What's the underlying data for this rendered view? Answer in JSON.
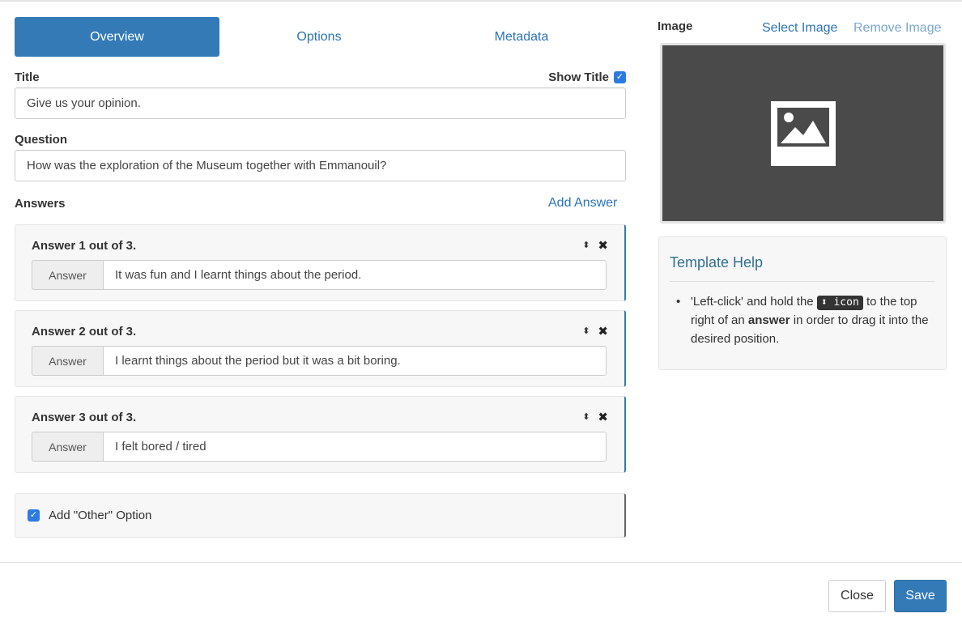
{
  "tabs": [
    {
      "label": "Overview",
      "active": true
    },
    {
      "label": "Options",
      "active": false
    },
    {
      "label": "Metadata",
      "active": false
    }
  ],
  "title_section": {
    "label": "Title",
    "show_title_label": "Show Title",
    "show_title_checked": true,
    "value": "Give us your opinion."
  },
  "question_section": {
    "label": "Question",
    "value": "How was the exploration of the Museum together with Emmanouil?"
  },
  "answers_section": {
    "label": "Answers",
    "add_answer_label": "Add Answer",
    "items": [
      {
        "title": "Answer 1 out of 3.",
        "addon": "Answer",
        "value": "It was fun and I learnt things about the period."
      },
      {
        "title": "Answer 2 out of 3.",
        "addon": "Answer",
        "value": "I learnt things about the period but it was a bit boring."
      },
      {
        "title": "Answer 3 out of 3.",
        "addon": "Answer",
        "value": "I felt bored / tired"
      }
    ]
  },
  "other_option": {
    "label": "Add \"Other\" Option",
    "checked": true
  },
  "image_section": {
    "label": "Image",
    "select_label": "Select Image",
    "remove_label": "Remove Image"
  },
  "template_help": {
    "title": "Template Help",
    "text_before": "'Left-click' and hold the",
    "code_label": "icon",
    "text_middle": "to the top right of an",
    "bold_word": "answer",
    "text_after": "in order to drag it into the desired position."
  },
  "footer": {
    "close_label": "Close",
    "save_label": "Save"
  },
  "colors": {
    "primary": "#337ab7",
    "link": "#2a74b8",
    "help_title": "#31708f",
    "checkbox": "#2d7be0"
  }
}
